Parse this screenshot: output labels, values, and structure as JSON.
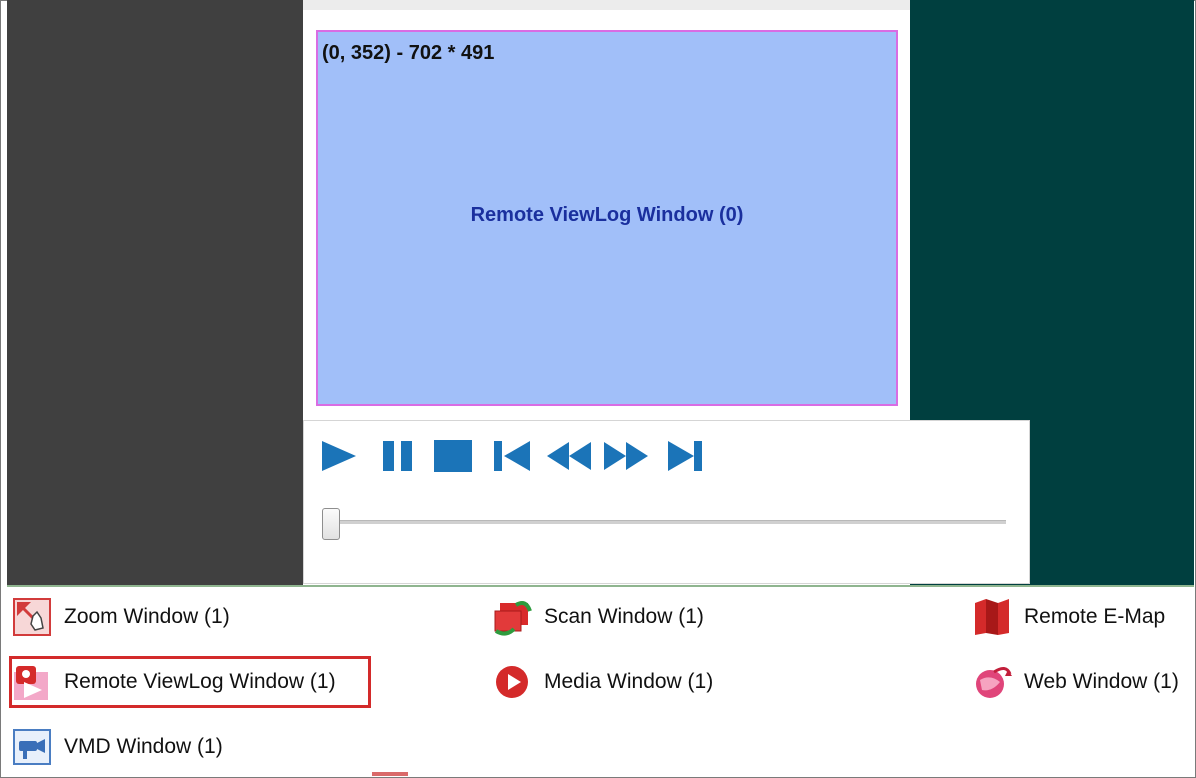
{
  "viewlog_pane": {
    "coords": "(0, 352) - 702 * 491",
    "title": "Remote ViewLog Window (0)"
  },
  "player": {
    "buttons": [
      "play-icon",
      "pause-icon",
      "stop-icon",
      "skip-to-start-icon",
      "rewind-icon",
      "fast-forward-icon",
      "skip-to-end-icon"
    ],
    "accent_color": "#1b74b8",
    "slider_position": 0
  },
  "windows": {
    "zoom": "Zoom Window (1)",
    "scan": "Scan Window (1)",
    "remote_emap": "Remote E-Map",
    "remote_viewlog": "Remote ViewLog Window (1)",
    "media": "Media Window (1)",
    "web": "Web Window (1)",
    "vmd": "VMD Window (1)"
  },
  "colors": {
    "pane_background": "#a1bff9",
    "pane_border": "#d96ce3",
    "selection_border": "#d32a2a",
    "right_background": "#003f3f",
    "left_background": "#404040"
  }
}
